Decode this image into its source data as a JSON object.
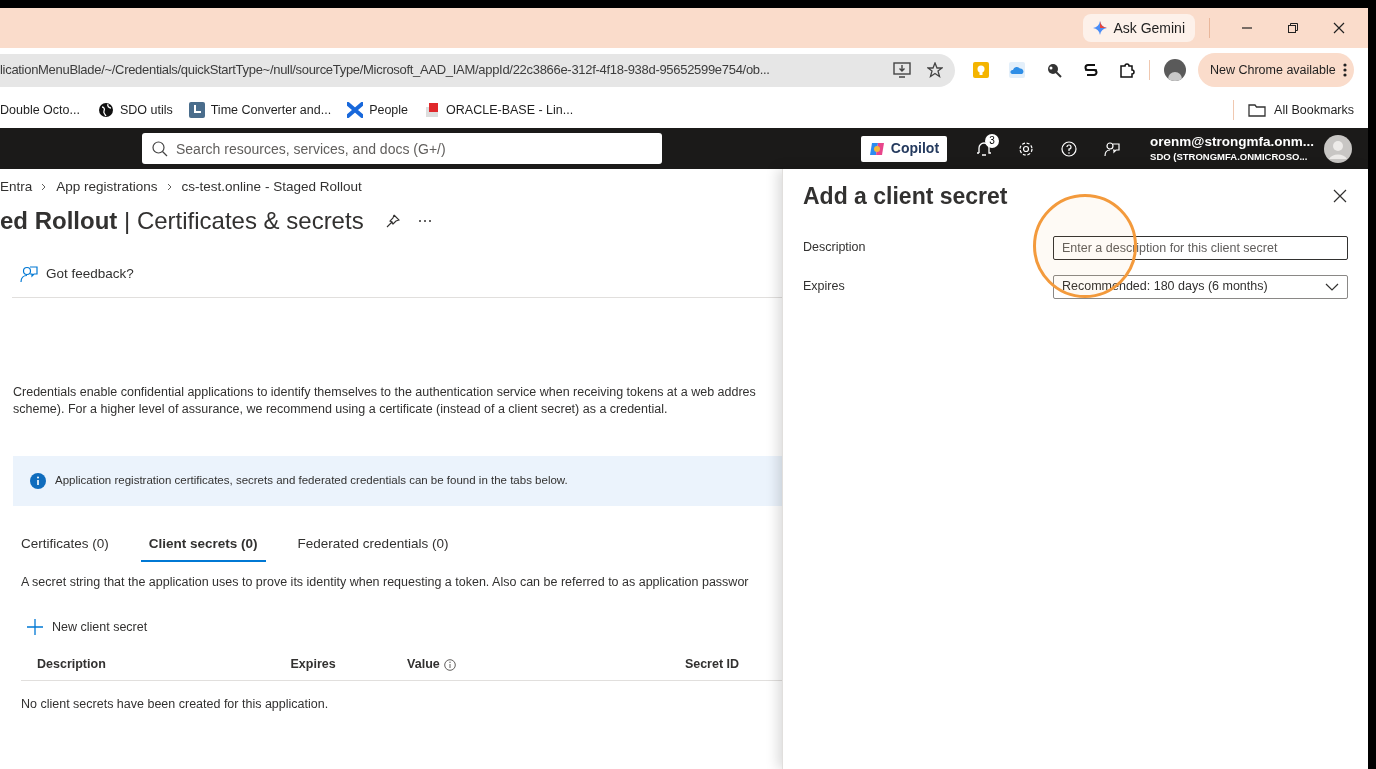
{
  "browser": {
    "ask_gemini": "Ask Gemini",
    "address": "licationMenuBlade/~/Credentials/quickStartType~/null/sourceType/Microsoft_AAD_IAM/appId/22c3866e-312f-4f18-938d-95652599e754/ob...",
    "update_button": "New Chrome available",
    "bookmarks": [
      {
        "label": "Double Octo...",
        "kind": "none"
      },
      {
        "label": "SDO utils",
        "kind": "globe"
      },
      {
        "label": "Time Converter and...",
        "kind": "clock"
      },
      {
        "label": "People",
        "kind": "cross"
      },
      {
        "label": "ORACLE-BASE - Lin...",
        "kind": "cube"
      }
    ],
    "all_bookmarks": "All Bookmarks"
  },
  "portal": {
    "search_placeholder": "Search resources, services, and docs (G+/)",
    "copilot": "Copilot",
    "notification_count": "3",
    "user_email": "orenm@strongmfa.onm...",
    "user_tenant": "SDO (STRONGMFA.ONMICROSO..."
  },
  "breadcrumb": [
    "Entra",
    "App registrations",
    "cs-test.online - Staged Rollout"
  ],
  "title": {
    "bold": "ed Rollout",
    "rest": "| Certificates & secrets"
  },
  "feedback": "Got feedback?",
  "intro": [
    "Credentials enable confidential applications to identify themselves to the authentication service when receiving tokens at a web addres",
    "scheme). For a higher level of assurance, we recommend using a certificate (instead of a client secret) as a credential."
  ],
  "info_banner": "Application registration certificates, secrets and federated credentials can be found in the tabs below.",
  "tabs": [
    {
      "label": "Certificates (0)",
      "selected": false
    },
    {
      "label": "Client secrets (0)",
      "selected": true
    },
    {
      "label": "Federated credentials (0)",
      "selected": false
    }
  ],
  "tab_description": "A secret string that the application uses to prove its identity when requesting a token. Also can be referred to as application passwor",
  "new_button": "New client secret",
  "table": {
    "columns": [
      {
        "label": "Description",
        "info": false
      },
      {
        "label": "Expires",
        "info": false
      },
      {
        "label": "Value",
        "info": true
      },
      {
        "label": "Secret ID",
        "info": false
      }
    ],
    "empty_message": "No client secrets have been created for this application."
  },
  "panel": {
    "title": "Add a client secret",
    "fields": [
      {
        "label": "Description",
        "kind": "text",
        "placeholder": "Enter a description for this client secret"
      },
      {
        "label": "Expires",
        "kind": "select",
        "value": "Recommended: 180 days (6 months)"
      }
    ]
  }
}
